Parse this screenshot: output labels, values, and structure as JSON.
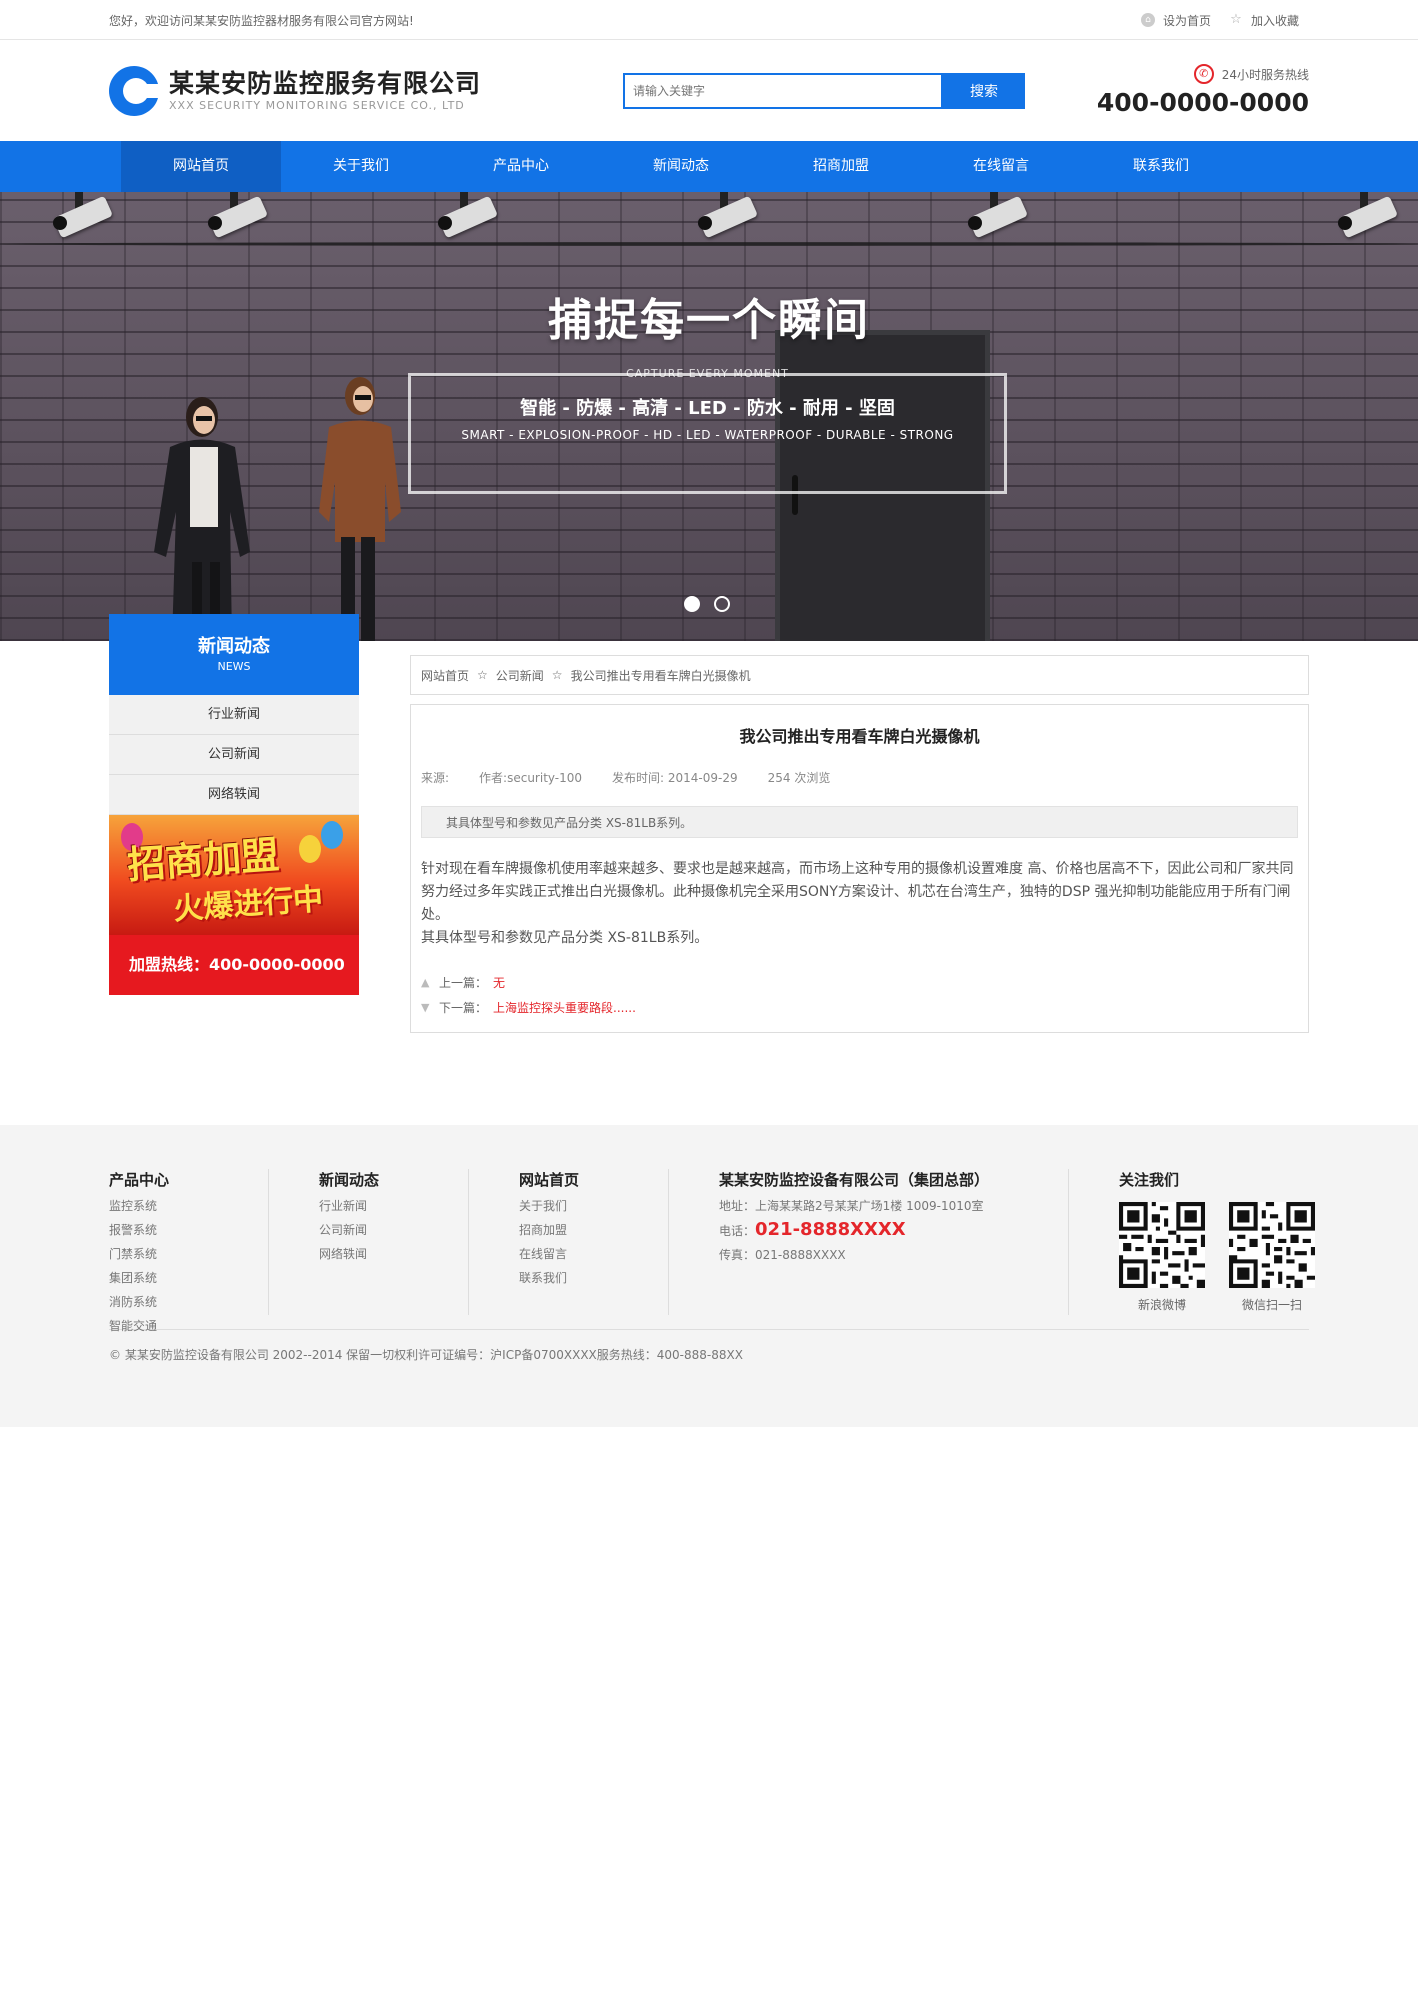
{
  "topbar": {
    "welcome": "您好，欢迎访问某某安防监控器材服务有限公司官方网站!",
    "set_home": "设为首页",
    "favorite": "加入收藏"
  },
  "header": {
    "logo_cn": "某某安防监控服务有限公司",
    "logo_en": "XXX SECURITY MONITORING SERVICE CO., LTD",
    "search_placeholder": "请输入关键字",
    "search_button": "搜索",
    "hotline_label": "24小时服务热线",
    "hotline_number": "400-0000-0000"
  },
  "nav": {
    "items": [
      "网站首页",
      "关于我们",
      "产品中心",
      "新闻动态",
      "招商加盟",
      "在线留言",
      "联系我们"
    ],
    "active_index": 0
  },
  "banner": {
    "title": "捕捉每一个瞬间",
    "caption": "CAPTURE EVERY MOMENT",
    "tags_cn": "智能 - 防爆 - 高清 - LED - 防水 - 耐用 - 坚固",
    "tags_en": "SMART - EXPLOSION-PROOF - HD - LED - WATERPROOF - DURABLE - STRONG",
    "slides": 2,
    "current_slide": 1
  },
  "sidebar": {
    "title": "新闻动态",
    "title_en": "NEWS",
    "items": [
      "行业新闻",
      "公司新闻",
      "网络轶闻"
    ],
    "promo_line1": "招商加盟",
    "promo_line2": "火爆进行中",
    "promo_hotline": "加盟热线：400-0000-0000"
  },
  "breadcrumb": {
    "items": [
      "网站首页",
      "公司新闻",
      "我公司推出专用看车牌白光摄像机"
    ]
  },
  "article": {
    "title": "我公司推出专用看车牌白光摄像机",
    "source": "来源:",
    "author": "作者:security-100",
    "date": "发布时间: 2014-09-29",
    "views": "254 次浏览",
    "summary": "其具体型号和参数见产品分类 XS-81LB系列。",
    "body1": "针对现在看车牌摄像机使用率越来越多、要求也是越来越高，而市场上这种专用的摄像机设置难度 高、价格也居高不下，因此公司和厂家共同努力经过多年实践正式推出白光摄像机。此种摄像机完全采用SONY方案设计、机芯在台湾生产，独特的DSP 强光抑制功能能应用于所有门闸处。",
    "body2": "其具体型号和参数见产品分类  XS-81LB系列。",
    "prev_label": "上一篇：",
    "prev_value": "无",
    "next_label": "下一篇：",
    "next_value": "上海监控探头重要路段......"
  },
  "footer": {
    "col1_title": "产品中心",
    "col1_links": [
      "监控系统",
      "报警系统",
      "门禁系统",
      "集团系统",
      "消防系统",
      "智能交通"
    ],
    "col2_title": "新闻动态",
    "col2_links": [
      "行业新闻",
      "公司新闻",
      "网络轶闻"
    ],
    "col3_title": "网站首页",
    "col3_links": [
      "关于我们",
      "招商加盟",
      "在线留言",
      "联系我们"
    ],
    "company_title": "某某安防监控设备有限公司（集团总部）",
    "address": "地址：上海某某路2号某某广场1楼 1009-1010室",
    "phone_label": "电话：",
    "phone": "021-8888XXXX",
    "fax": "传真：021-8888XXXX",
    "follow_title": "关注我们",
    "qr1_label": "新浪微博",
    "qr2_label": "微信扫一扫",
    "copyright": "© 某某安防监控设备有限公司 2002--2014 保留一切权利许可证编号：沪ICP备0700XXXX服务热线：400-888-88XX"
  },
  "colors": {
    "brand_blue": "#1273e6",
    "accent_red": "#e4262b"
  }
}
